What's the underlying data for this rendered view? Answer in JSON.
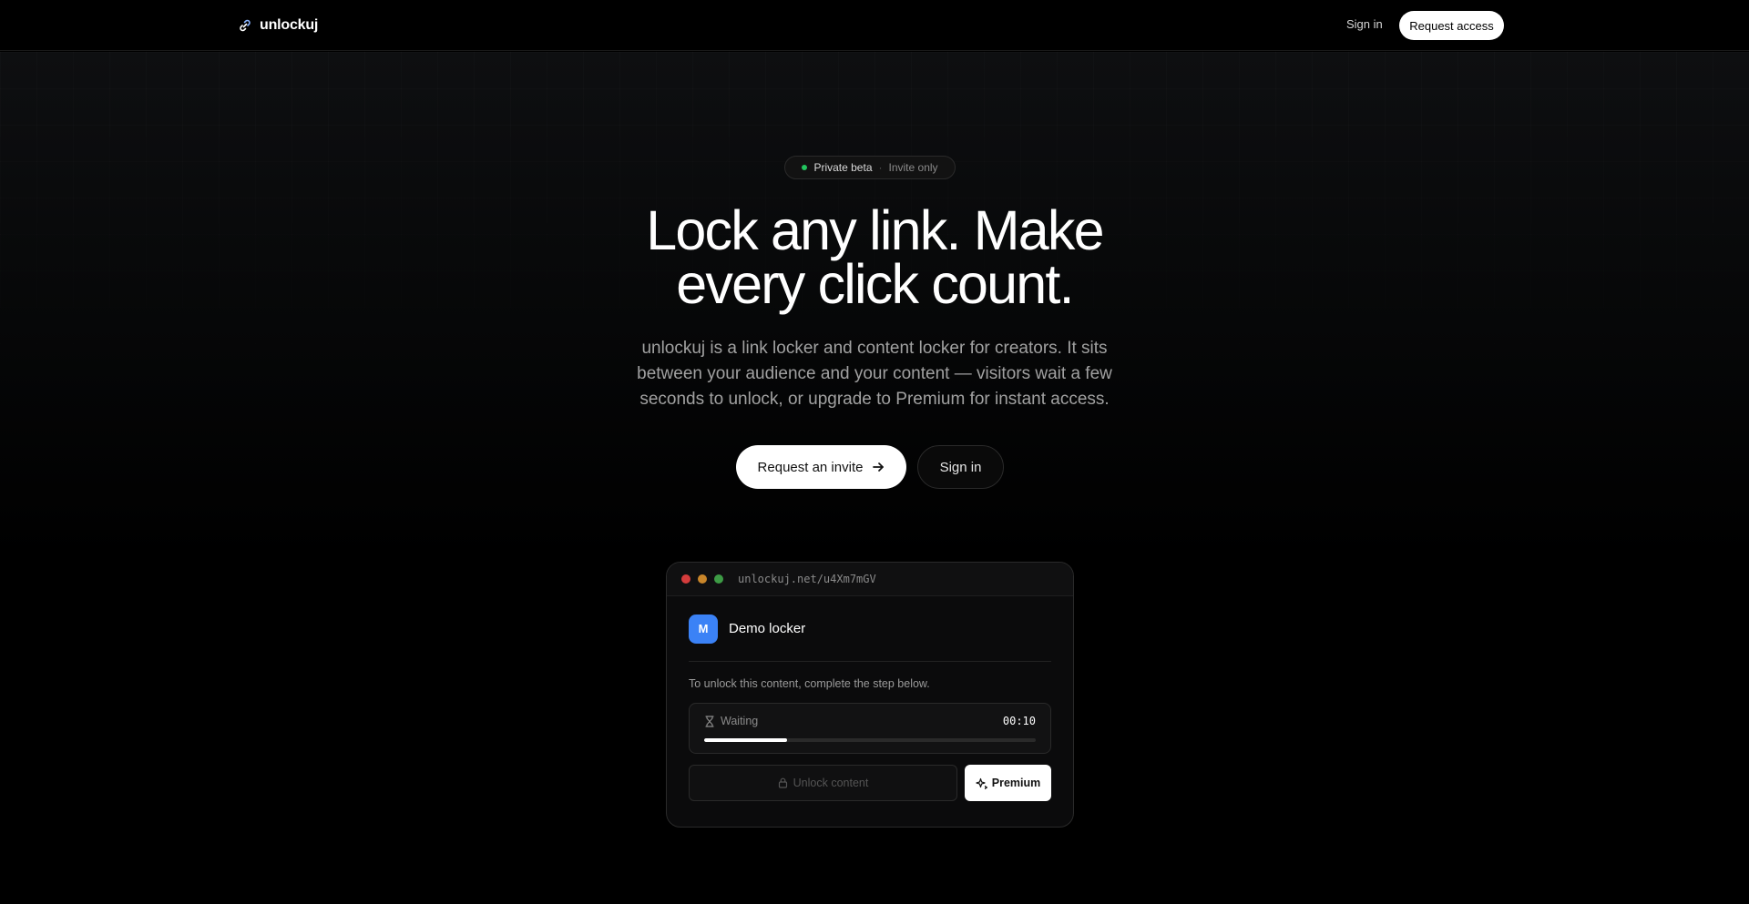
{
  "header": {
    "brand_name": "unlockuj",
    "brand_icon": "link-icon",
    "nav_signin": "Sign in",
    "nav_request": "Request access"
  },
  "hero": {
    "badge_main": "Private beta",
    "badge_separator": "·",
    "badge_sub": "Invite only",
    "headline_line1": "Lock any link. Make",
    "headline_line2": "every click count.",
    "subtitle": "unlockuj is a link locker and content locker for creators. It sits between your audience and your content — visitors wait a few seconds to unlock, or upgrade to Premium for instant access.",
    "cta_primary": "Request an invite",
    "cta_primary_icon": "arrow-right-icon",
    "cta_secondary": "Sign in"
  },
  "demo": {
    "url": "unlockuj.net/u4Xm7mGV",
    "window_dots": [
      "#d43c3c",
      "#c9862a",
      "#3d9b45"
    ],
    "avatar_letter": "M",
    "avatar_color": "#3b82f6",
    "locker_title": "Demo locker",
    "instruction": "To unlock this content, complete the step below.",
    "wait_label": "Waiting",
    "wait_icon": "hourglass-icon",
    "timer": "00:10",
    "progress_percent": 25,
    "unlock_label": "Unlock content",
    "unlock_icon": "lock-icon",
    "premium_label": "Premium",
    "premium_icon": "sparkle-icon"
  },
  "colors": {
    "background": "#000000",
    "accent_green": "#22c55e",
    "text_muted": "#a1a1a1"
  }
}
